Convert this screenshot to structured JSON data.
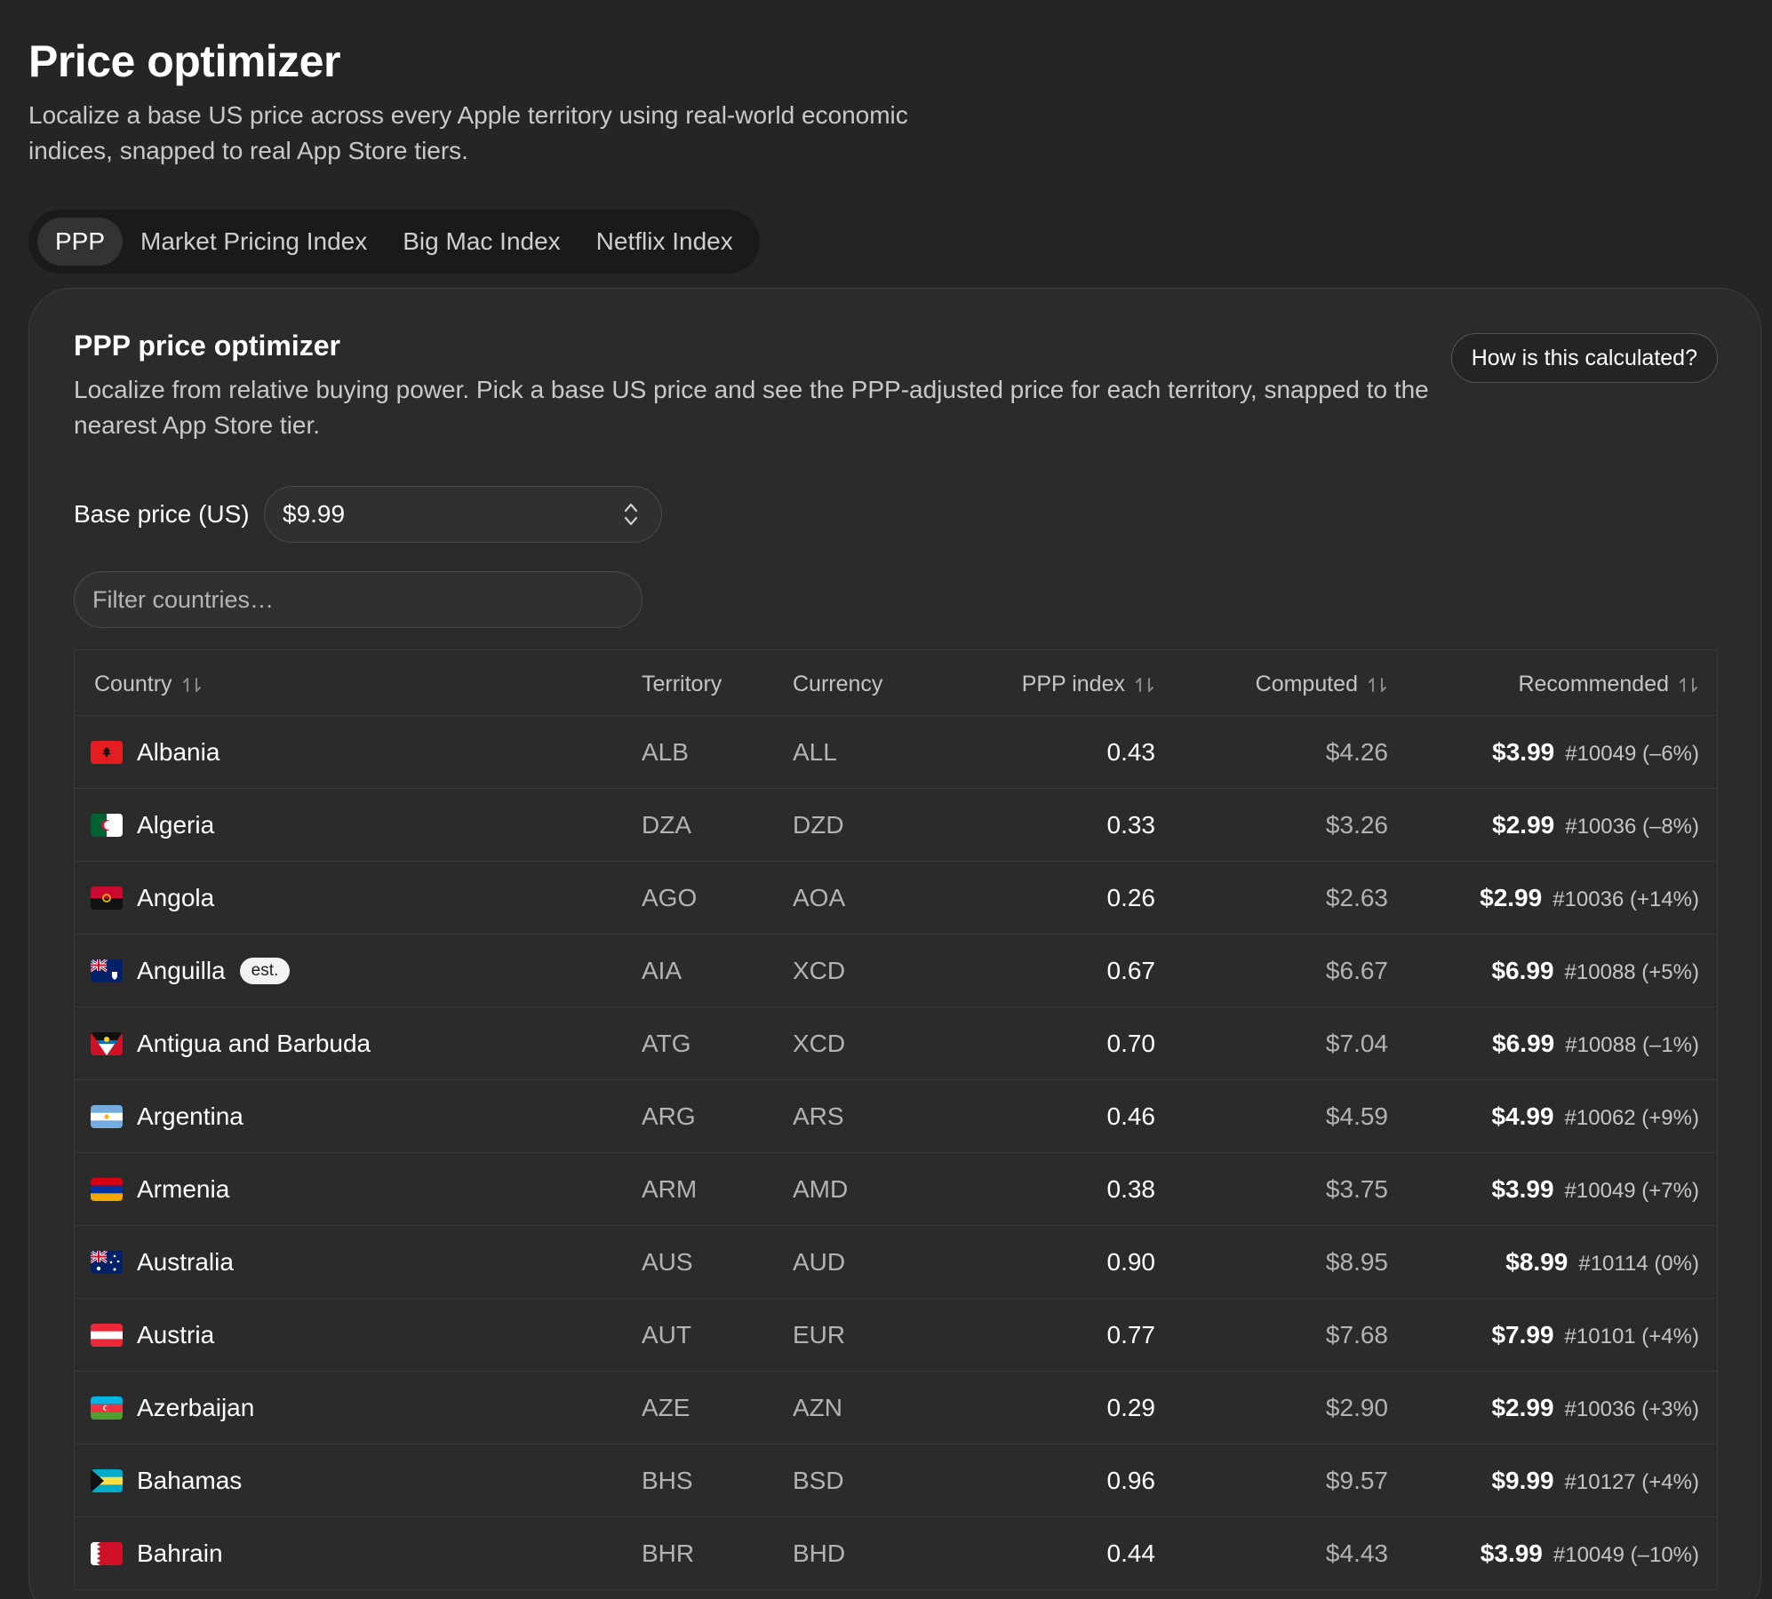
{
  "header": {
    "title": "Price optimizer",
    "subtitle": "Localize a base US price across every Apple territory using real-world economic indices, snapped to real App Store tiers."
  },
  "tabs": [
    {
      "label": "PPP",
      "active": true
    },
    {
      "label": "Market Pricing Index",
      "active": false
    },
    {
      "label": "Big Mac Index",
      "active": false
    },
    {
      "label": "Netflix Index",
      "active": false
    }
  ],
  "card": {
    "title": "PPP price optimizer",
    "description": "Localize from relative buying power. Pick a base US price and see the PPP-adjusted price for each territory, snapped to the nearest App Store tier.",
    "help_button": "How is this calculated?",
    "base_price": {
      "label": "Base price (US)",
      "value": "$9.99"
    },
    "filter": {
      "placeholder": "Filter countries…"
    }
  },
  "table": {
    "columns": {
      "country": "Country",
      "territory": "Territory",
      "currency": "Currency",
      "ppp": "PPP index",
      "computed": "Computed",
      "recommended": "Recommended"
    },
    "rows": [
      {
        "country": "Albania",
        "badge": "",
        "territory": "ALB",
        "currency": "ALL",
        "ppp": "0.43",
        "computed": "$4.26",
        "rec_price": "$3.99",
        "rec_tier": "#10049 (–6%)",
        "flag": "albania"
      },
      {
        "country": "Algeria",
        "badge": "",
        "territory": "DZA",
        "currency": "DZD",
        "ppp": "0.33",
        "computed": "$3.26",
        "rec_price": "$2.99",
        "rec_tier": "#10036 (–8%)",
        "flag": "algeria"
      },
      {
        "country": "Angola",
        "badge": "",
        "territory": "AGO",
        "currency": "AOA",
        "ppp": "0.26",
        "computed": "$2.63",
        "rec_price": "$2.99",
        "rec_tier": "#10036 (+14%)",
        "flag": "angola"
      },
      {
        "country": "Anguilla",
        "badge": "est.",
        "territory": "AIA",
        "currency": "XCD",
        "ppp": "0.67",
        "computed": "$6.67",
        "rec_price": "$6.99",
        "rec_tier": "#10088 (+5%)",
        "flag": "anguilla"
      },
      {
        "country": "Antigua and Barbuda",
        "badge": "",
        "territory": "ATG",
        "currency": "XCD",
        "ppp": "0.70",
        "computed": "$7.04",
        "rec_price": "$6.99",
        "rec_tier": "#10088 (–1%)",
        "flag": "antigua"
      },
      {
        "country": "Argentina",
        "badge": "",
        "territory": "ARG",
        "currency": "ARS",
        "ppp": "0.46",
        "computed": "$4.59",
        "rec_price": "$4.99",
        "rec_tier": "#10062 (+9%)",
        "flag": "argentina"
      },
      {
        "country": "Armenia",
        "badge": "",
        "territory": "ARM",
        "currency": "AMD",
        "ppp": "0.38",
        "computed": "$3.75",
        "rec_price": "$3.99",
        "rec_tier": "#10049 (+7%)",
        "flag": "armenia"
      },
      {
        "country": "Australia",
        "badge": "",
        "territory": "AUS",
        "currency": "AUD",
        "ppp": "0.90",
        "computed": "$8.95",
        "rec_price": "$8.99",
        "rec_tier": "#10114 (0%)",
        "flag": "australia"
      },
      {
        "country": "Austria",
        "badge": "",
        "territory": "AUT",
        "currency": "EUR",
        "ppp": "0.77",
        "computed": "$7.68",
        "rec_price": "$7.99",
        "rec_tier": "#10101 (+4%)",
        "flag": "austria"
      },
      {
        "country": "Azerbaijan",
        "badge": "",
        "territory": "AZE",
        "currency": "AZN",
        "ppp": "0.29",
        "computed": "$2.90",
        "rec_price": "$2.99",
        "rec_tier": "#10036 (+3%)",
        "flag": "azerbaijan"
      },
      {
        "country": "Bahamas",
        "badge": "",
        "territory": "BHS",
        "currency": "BSD",
        "ppp": "0.96",
        "computed": "$9.57",
        "rec_price": "$9.99",
        "rec_tier": "#10127 (+4%)",
        "flag": "bahamas"
      },
      {
        "country": "Bahrain",
        "badge": "",
        "territory": "BHR",
        "currency": "BHD",
        "ppp": "0.44",
        "computed": "$4.43",
        "rec_price": "$3.99",
        "rec_tier": "#10049 (–10%)",
        "flag": "bahrain"
      }
    ]
  }
}
